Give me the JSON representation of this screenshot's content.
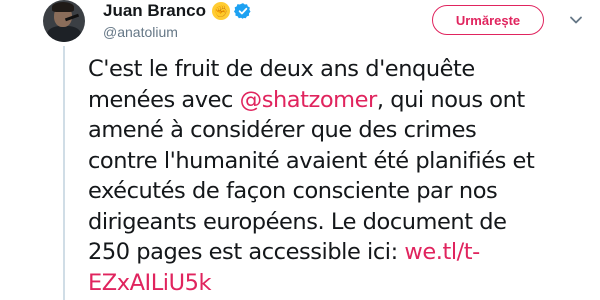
{
  "author": {
    "display_name": "Juan Branco",
    "handle": "@anatolium",
    "emoji_icon": "raised-fist-emoji",
    "verified_icon": "verified-badge-icon"
  },
  "follow_button": {
    "label": "Urmărește"
  },
  "colors": {
    "accent": "#e0245e",
    "verified": "#1da1f2",
    "muted": "#657786",
    "text": "#14171a"
  },
  "tweet": {
    "line1": "C'est le fruit de deux ans d'enquête",
    "line2_pre": "menées avec ",
    "mention": "@shatzomer",
    "line2_post": ", qui nous ont",
    "line3": "amené à considérer que des crimes",
    "line4": "contre l'humanité avaient été planifiés et",
    "line5": "exécutés de façon consciente par nos",
    "line6": "dirigeants européens. Le document de",
    "line7_pre": "250 pages est accessible ici: ",
    "link_part1": "we.tl/t-",
    "link_part2": "EZxAILiU5k"
  }
}
